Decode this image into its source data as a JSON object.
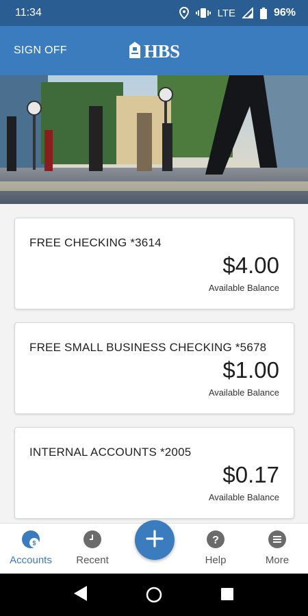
{
  "status_bar": {
    "time": "11:34",
    "network": "LTE",
    "battery": "96%"
  },
  "header": {
    "sign_off": "SIGN OFF",
    "logo_text": "HBS"
  },
  "accounts": [
    {
      "name": "FREE CHECKING *3614",
      "balance": "$4.00",
      "balance_label": "Available Balance"
    },
    {
      "name": "FREE SMALL BUSINESS CHECKING *5678",
      "balance": "$1.00",
      "balance_label": "Available Balance"
    },
    {
      "name": "INTERNAL ACCOUNTS *2005",
      "balance": "$0.17",
      "balance_label": "Available Balance"
    }
  ],
  "bottom_nav": {
    "accounts_label": "Accounts",
    "recent_label": "Recent",
    "help_label": "Help",
    "more_label": "More",
    "add_icon": "plus-icon"
  },
  "colors": {
    "primary": "#3b7cbf",
    "status_bar": "#2a5e93",
    "background": "#f3f3f3"
  }
}
